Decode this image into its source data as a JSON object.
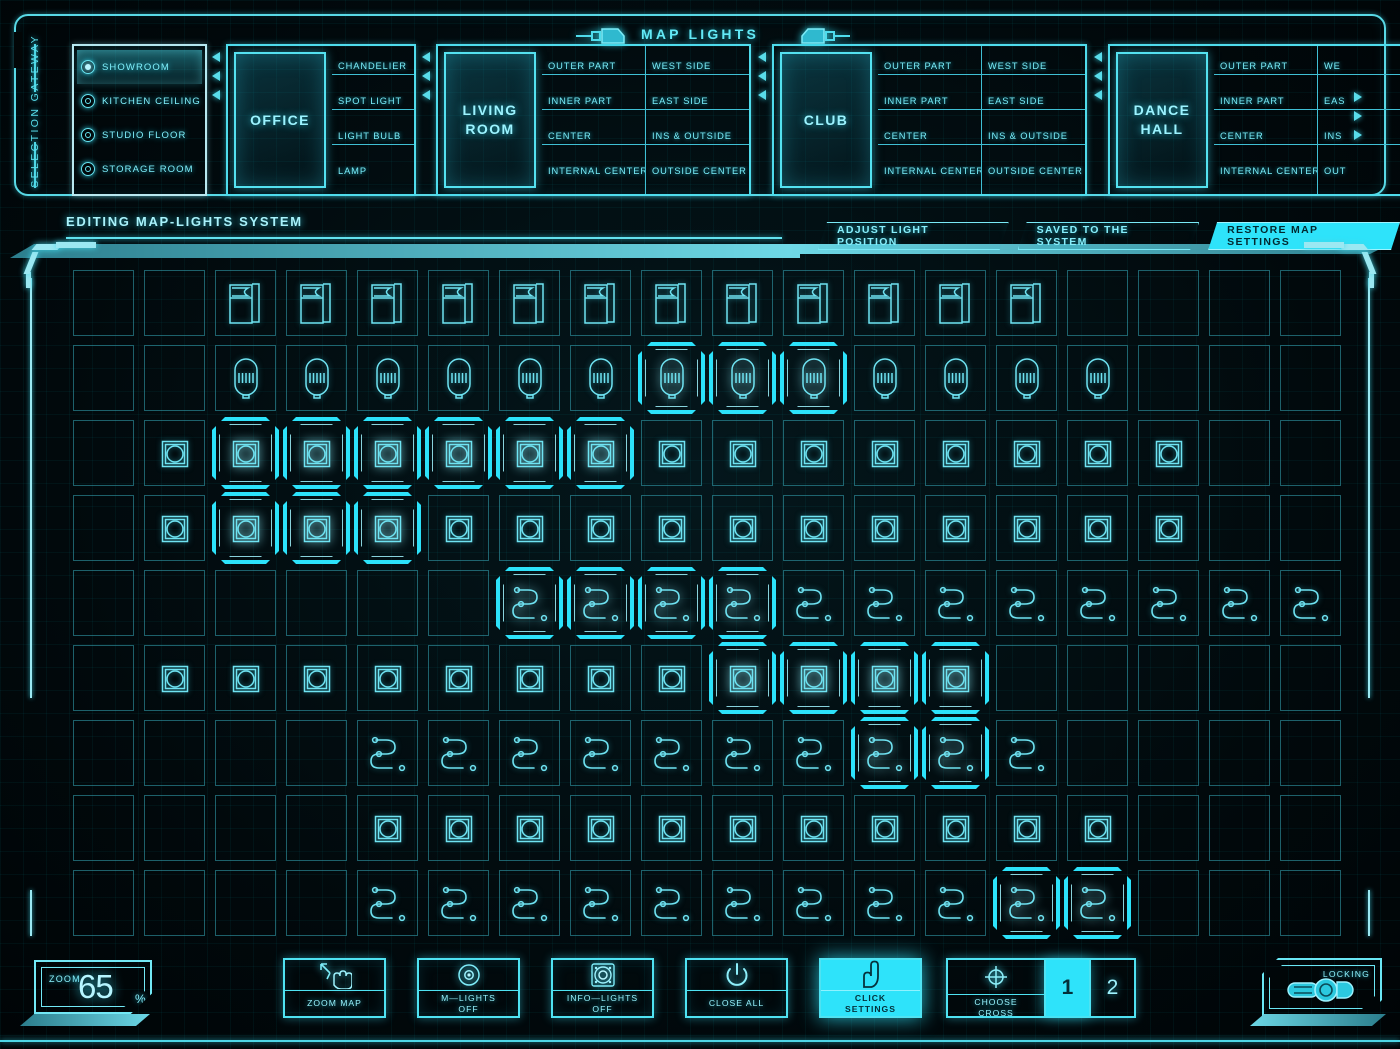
{
  "header": {
    "title": "MAP LIGHTS",
    "gateway_label": "SELECTION GATEWAY",
    "plug_left_icon": "plug-connector-icon",
    "plug_right_icon": "plug-connector-icon"
  },
  "rooms": {
    "items": [
      {
        "label": "SHOWROOM",
        "selected": true
      },
      {
        "label": "KITCHEN CEILING",
        "selected": false
      },
      {
        "label": "STUDIO FLOOR",
        "selected": false
      },
      {
        "label": "STORAGE ROOM",
        "selected": false
      }
    ]
  },
  "cards": [
    {
      "name": "OFFICE",
      "columns": [
        [
          "CHANDELIER",
          "SPOT LIGHT",
          "LIGHT BULB",
          "LAMP"
        ]
      ]
    },
    {
      "name": "LIVING ROOM",
      "columns": [
        [
          "OUTER PART",
          "INNER PART",
          "CENTER",
          "INTERNAL CENTER"
        ],
        [
          "WEST SIDE",
          "EAST SIDE",
          "INS &  OUTSIDE",
          "OUTSIDE CENTER"
        ]
      ]
    },
    {
      "name": "CLUB",
      "columns": [
        [
          "OUTER PART",
          "INNER PART",
          "CENTER",
          "INTERNAL CENTER"
        ],
        [
          "WEST SIDE",
          "EAST SIDE",
          "INS &  OUTSIDE",
          "OUTSIDE CENTER"
        ]
      ]
    },
    {
      "name": "DANCE HALL",
      "columns": [
        [
          "OUTER PART",
          "INNER PART",
          "CENTER",
          "INTERNAL CENTER"
        ],
        [
          "WE",
          "EAS",
          "INS",
          "OUT"
        ]
      ]
    }
  ],
  "editor": {
    "title": "EDITING MAP-LIGHTS SYSTEM",
    "buttons": [
      {
        "label": "ADJUST LIGHT POSITION",
        "active": false
      },
      {
        "label": "SAVED TO THE SYSTEM",
        "active": false
      },
      {
        "label": "RESTORE MAP SETTINGS",
        "active": true
      }
    ]
  },
  "grid": {
    "columns": 18,
    "rows": 9,
    "icon_legend": {
      "fridge": "refrigerator-icon",
      "lamp": "lamp-icon",
      "socket": "socket-icon",
      "wire": "wire-icon"
    },
    "cells": [
      {
        "row": 1,
        "type": "fridge",
        "from": 3,
        "to": 14,
        "on": []
      },
      {
        "row": 2,
        "type": "lamp",
        "from": 3,
        "to": 15,
        "on": [
          9,
          10,
          11
        ]
      },
      {
        "row": 3,
        "type": "socket",
        "from": 2,
        "to": 16,
        "on": [
          3,
          4,
          5,
          6,
          7,
          8
        ]
      },
      {
        "row": 4,
        "type": "socket",
        "from": 2,
        "to": 16,
        "on": [
          3,
          4,
          5
        ]
      },
      {
        "row": 5,
        "type": "wire",
        "from": 7,
        "to": 18,
        "on": [
          7,
          8,
          9,
          10
        ]
      },
      {
        "row": 6,
        "type": "socket",
        "from": 2,
        "to": 13,
        "on": [
          10,
          11,
          12,
          13
        ]
      },
      {
        "row": 7,
        "type": "wire",
        "from": 5,
        "to": 14,
        "on": [
          12,
          13
        ]
      },
      {
        "row": 8,
        "type": "socket",
        "from": 5,
        "to": 15,
        "on": []
      },
      {
        "row": 9,
        "type": "wire",
        "from": 5,
        "to": 15,
        "on": [
          14,
          15
        ]
      }
    ]
  },
  "footer": {
    "zoom": {
      "word": "ZOOM",
      "value": "65",
      "unit": "%"
    },
    "tools": [
      {
        "label": "ZOOM MAP",
        "icon": "hand-resize-icon",
        "active": false
      },
      {
        "label": "M—LIGHTS\nOFF",
        "icon": "dot-target-icon",
        "active": false
      },
      {
        "label": "INFO—LIGHTS\nOFF",
        "icon": "speaker-info-icon",
        "active": false
      },
      {
        "label": "CLOSE ALL",
        "icon": "power-icon",
        "active": false
      },
      {
        "label": "CLICK\nSETTINGS",
        "icon": "hand-click-icon",
        "active": true
      }
    ],
    "cross": {
      "label": "CHOOSE\nCROSS",
      "icon": "crosshair-icon",
      "options": [
        {
          "value": "1",
          "selected": true
        },
        {
          "value": "2",
          "selected": false
        }
      ]
    },
    "lock": {
      "label": "LOCKING",
      "icon": "lock-toggle-icon"
    }
  },
  "theme": {
    "accent": "#2ee3fa",
    "line": "#4fe2f2",
    "text": "#8ceffb",
    "background": "#020607",
    "dim_line": "#2e96a5"
  }
}
